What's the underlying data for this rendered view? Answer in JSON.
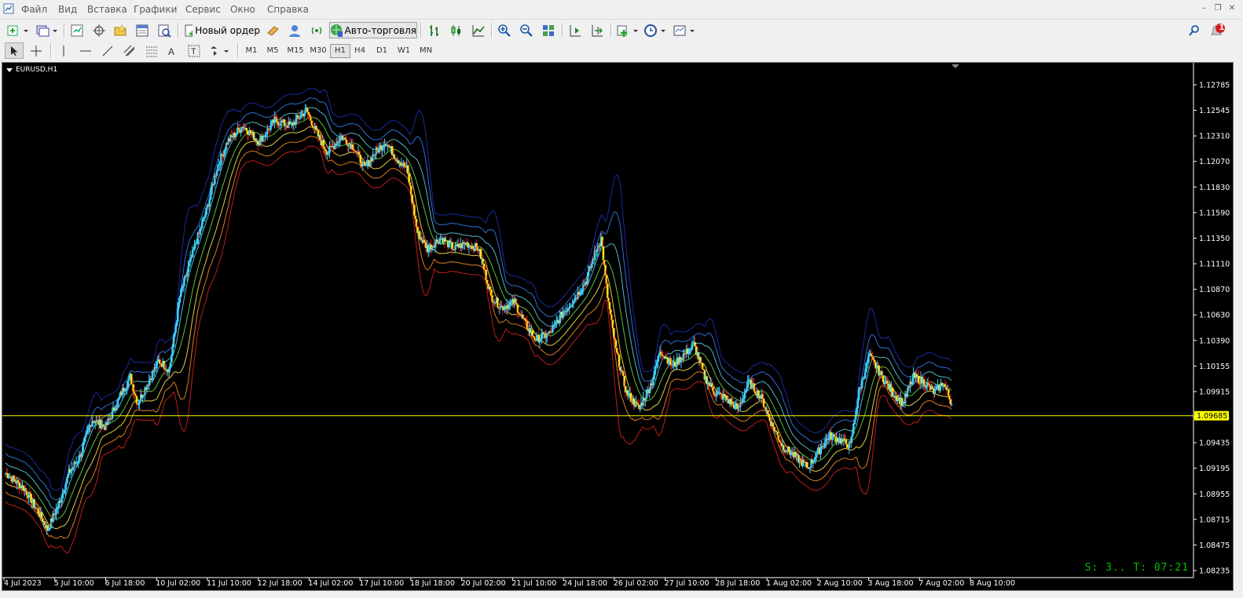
{
  "menu": [
    "Файл",
    "Вид",
    "Вставка",
    "Графики",
    "Сервис",
    "Окно",
    "Справка"
  ],
  "toolbar": {
    "new_order_label": "Новый ордер",
    "autotrading_label": "Авто-торговля",
    "notification_count": "1"
  },
  "timeframes": [
    "M1",
    "M5",
    "M15",
    "M30",
    "H1",
    "H4",
    "D1",
    "W1",
    "MN"
  ],
  "active_timeframe": "H1",
  "chart": {
    "symbol_label": "EURUSD,H1",
    "current_price": "1.09685",
    "status_text": "S: 3.. T: 07:21"
  },
  "colors": {
    "background": "#000000",
    "bull_candle": "#3ecdf5",
    "bear_candle": "#ffe11a",
    "band_outer_upper": "#1a2aa0",
    "band_upper_2": "#2e6fd6",
    "band_upper_1": "#4fb8c8",
    "band_middle": "#5fbf3a",
    "band_lower_1": "#e0d040",
    "band_lower_2": "#e07a20",
    "band_outer_lower": "#c01c1c",
    "price_line": "#ffff00",
    "status_text": "#00c000"
  },
  "chart_data": {
    "type": "candlestick",
    "x_ticks": [
      "4 Jul 2023",
      "5 Jul 10:00",
      "6 Jul 18:00",
      "10 Jul 02:00",
      "11 Jul 10:00",
      "12 Jul 18:00",
      "14 Jul 02:00",
      "17 Jul 10:00",
      "18 Jul 18:00",
      "20 Jul 02:00",
      "21 Jul 10:00",
      "24 Jul 18:00",
      "26 Jul 02:00",
      "27 Jul 10:00",
      "28 Jul 18:00",
      "1 Aug 02:00",
      "2 Aug 10:00",
      "3 Aug 18:00",
      "7 Aug 02:00",
      "8 Aug 10:00"
    ],
    "y_ticks": [
      "1.12785",
      "1.12545",
      "1.12310",
      "1.12070",
      "1.11830",
      "1.11590",
      "1.11350",
      "1.11110",
      "1.10870",
      "1.10630",
      "1.10390",
      "1.10155",
      "1.09915",
      "1.09675",
      "1.09435",
      "1.09195",
      "1.08955",
      "1.08715",
      "1.08475",
      "1.08235"
    ],
    "y_range": [
      1.08235,
      1.12785
    ],
    "price_path": [
      [
        0,
        1.0915
      ],
      [
        18,
        1.09
      ],
      [
        30,
        1.088
      ],
      [
        40,
        1.0862
      ],
      [
        52,
        1.089
      ],
      [
        60,
        1.0915
      ],
      [
        70,
        1.093
      ],
      [
        82,
        1.0965
      ],
      [
        95,
        1.0958
      ],
      [
        110,
        1.099
      ],
      [
        118,
        1.1005
      ],
      [
        125,
        1.098
      ],
      [
        135,
        1.1
      ],
      [
        145,
        1.102
      ],
      [
        155,
        1.1012
      ],
      [
        165,
        1.108
      ],
      [
        180,
        1.113
      ],
      [
        190,
        1.116
      ],
      [
        200,
        1.12
      ],
      [
        210,
        1.1225
      ],
      [
        225,
        1.124
      ],
      [
        240,
        1.1225
      ],
      [
        255,
        1.1245
      ],
      [
        270,
        1.124
      ],
      [
        285,
        1.1255
      ],
      [
        295,
        1.1232
      ],
      [
        305,
        1.1215
      ],
      [
        318,
        1.123
      ],
      [
        330,
        1.122
      ],
      [
        340,
        1.12
      ],
      [
        350,
        1.1215
      ],
      [
        360,
        1.1225
      ],
      [
        370,
        1.121
      ],
      [
        380,
        1.12
      ],
      [
        390,
        1.114
      ],
      [
        400,
        1.1125
      ],
      [
        412,
        1.1135
      ],
      [
        425,
        1.1125
      ],
      [
        436,
        1.113
      ],
      [
        448,
        1.1125
      ],
      [
        460,
        1.108
      ],
      [
        470,
        1.107
      ],
      [
        482,
        1.1075
      ],
      [
        492,
        1.1055
      ],
      [
        502,
        1.104
      ],
      [
        515,
        1.1045
      ],
      [
        528,
        1.1065
      ],
      [
        540,
        1.108
      ],
      [
        550,
        1.1095
      ],
      [
        558,
        1.112
      ],
      [
        564,
        1.1135
      ],
      [
        570,
        1.108
      ],
      [
        578,
        1.103
      ],
      [
        588,
        1.099
      ],
      [
        600,
        1.0975
      ],
      [
        612,
        1.1
      ],
      [
        620,
        1.103
      ],
      [
        632,
        1.1015
      ],
      [
        642,
        1.1025
      ],
      [
        652,
        1.1035
      ],
      [
        662,
        1.1005
      ],
      [
        672,
        1.099
      ],
      [
        682,
        1.0985
      ],
      [
        694,
        1.0975
      ],
      [
        704,
        1.1
      ],
      [
        716,
        1.0985
      ],
      [
        726,
        1.096
      ],
      [
        736,
        1.094
      ],
      [
        748,
        1.093
      ],
      [
        760,
        1.092
      ],
      [
        770,
        1.0935
      ],
      [
        780,
        1.095
      ],
      [
        792,
        1.0945
      ],
      [
        800,
        1.094
      ],
      [
        808,
        1.099
      ],
      [
        818,
        1.1025
      ],
      [
        830,
        1.1005
      ],
      [
        840,
        1.099
      ],
      [
        850,
        1.098
      ],
      [
        860,
        1.1005
      ],
      [
        870,
        1.1
      ],
      [
        880,
        1.099
      ],
      [
        888,
        1.1
      ],
      [
        896,
        1.098
      ]
    ]
  }
}
